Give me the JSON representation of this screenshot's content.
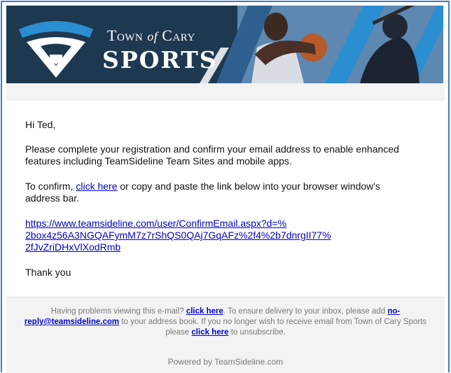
{
  "banner": {
    "brand_town": "Town",
    "brand_of": "of",
    "brand_cary": "Cary",
    "brand_sports": "SPORTS",
    "colors": {
      "navy": "#1e3850",
      "sky": "#5d88b1",
      "accent": "#2a8ed1"
    }
  },
  "email": {
    "greeting": "Hi Ted,",
    "para1_line1": "Please complete your registration and confirm your email address to enable enhanced",
    "para1_line2": "features including TeamSideline Team Sites and mobile apps.",
    "confirm_prefix": "To confirm,",
    "confirm_link": "click here",
    "confirm_suffix": "or copy and paste the link below into your browser window's",
    "confirm_line2": "address bar.",
    "url_line1": "https://www.teamsideline.com/user/ConfirmEmail.aspx?d=%",
    "url_line2": "2box4z56A3NGQAFymM7z7rShQS0QAj7GqAFz%2f4%2b7dnrgII77%",
    "url_line3": "2fJvZriDHxVlXodRmb",
    "signoff": "Thank you"
  },
  "footer": {
    "problems_prefix": "Having problems viewing this e-mail?",
    "problems_link": "click here",
    "delivery_text": ". To ensure delivery to your inbox, please add",
    "email_link_part1": "no-",
    "email_link_part2": "reply@teamsideline.com",
    "addressbook_text": "to your address book. If you no longer wish to receive email from Town of Cary Sports",
    "please_text": "please",
    "unsubscribe_link": "click here",
    "unsubscribe_suffix": "to unsubscribe.",
    "powered_by": "Powered by TeamSideline.com"
  }
}
